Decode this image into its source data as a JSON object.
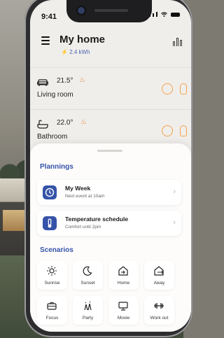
{
  "status_bar": {
    "time": "9:41"
  },
  "header": {
    "title": "My home",
    "power": "2.4 kWh"
  },
  "rooms": [
    {
      "temperature": "21.5°",
      "name": "Living room",
      "icon": "sofa-icon"
    },
    {
      "temperature": "22.0°",
      "name": "Bathroom",
      "icon": "bathtub-icon"
    }
  ],
  "plannings": {
    "heading": "Plannings",
    "items": [
      {
        "title": "My Week",
        "subtitle": "Next event at 10am",
        "icon": "clock-icon"
      },
      {
        "title": "Temperature schedule",
        "subtitle": "Comfort until 2pm",
        "icon": "thermometer-icon"
      }
    ]
  },
  "scenarios": {
    "heading": "Scenarios",
    "items": [
      {
        "label": "Sunrise",
        "icon": "sun-icon"
      },
      {
        "label": "Sunset",
        "icon": "moon-icon"
      },
      {
        "label": "Home",
        "icon": "home-in-icon"
      },
      {
        "label": "Away",
        "icon": "home-out-icon"
      },
      {
        "label": "Focus",
        "icon": "briefcase-icon"
      },
      {
        "label": "Party",
        "icon": "party-icon"
      },
      {
        "label": "Movie",
        "icon": "monitor-icon"
      },
      {
        "label": "Work out",
        "icon": "dumbbell-icon"
      }
    ]
  },
  "colors": {
    "accent": "#3553a8",
    "flame": "#e07b2a",
    "action": "#f2a24a"
  }
}
